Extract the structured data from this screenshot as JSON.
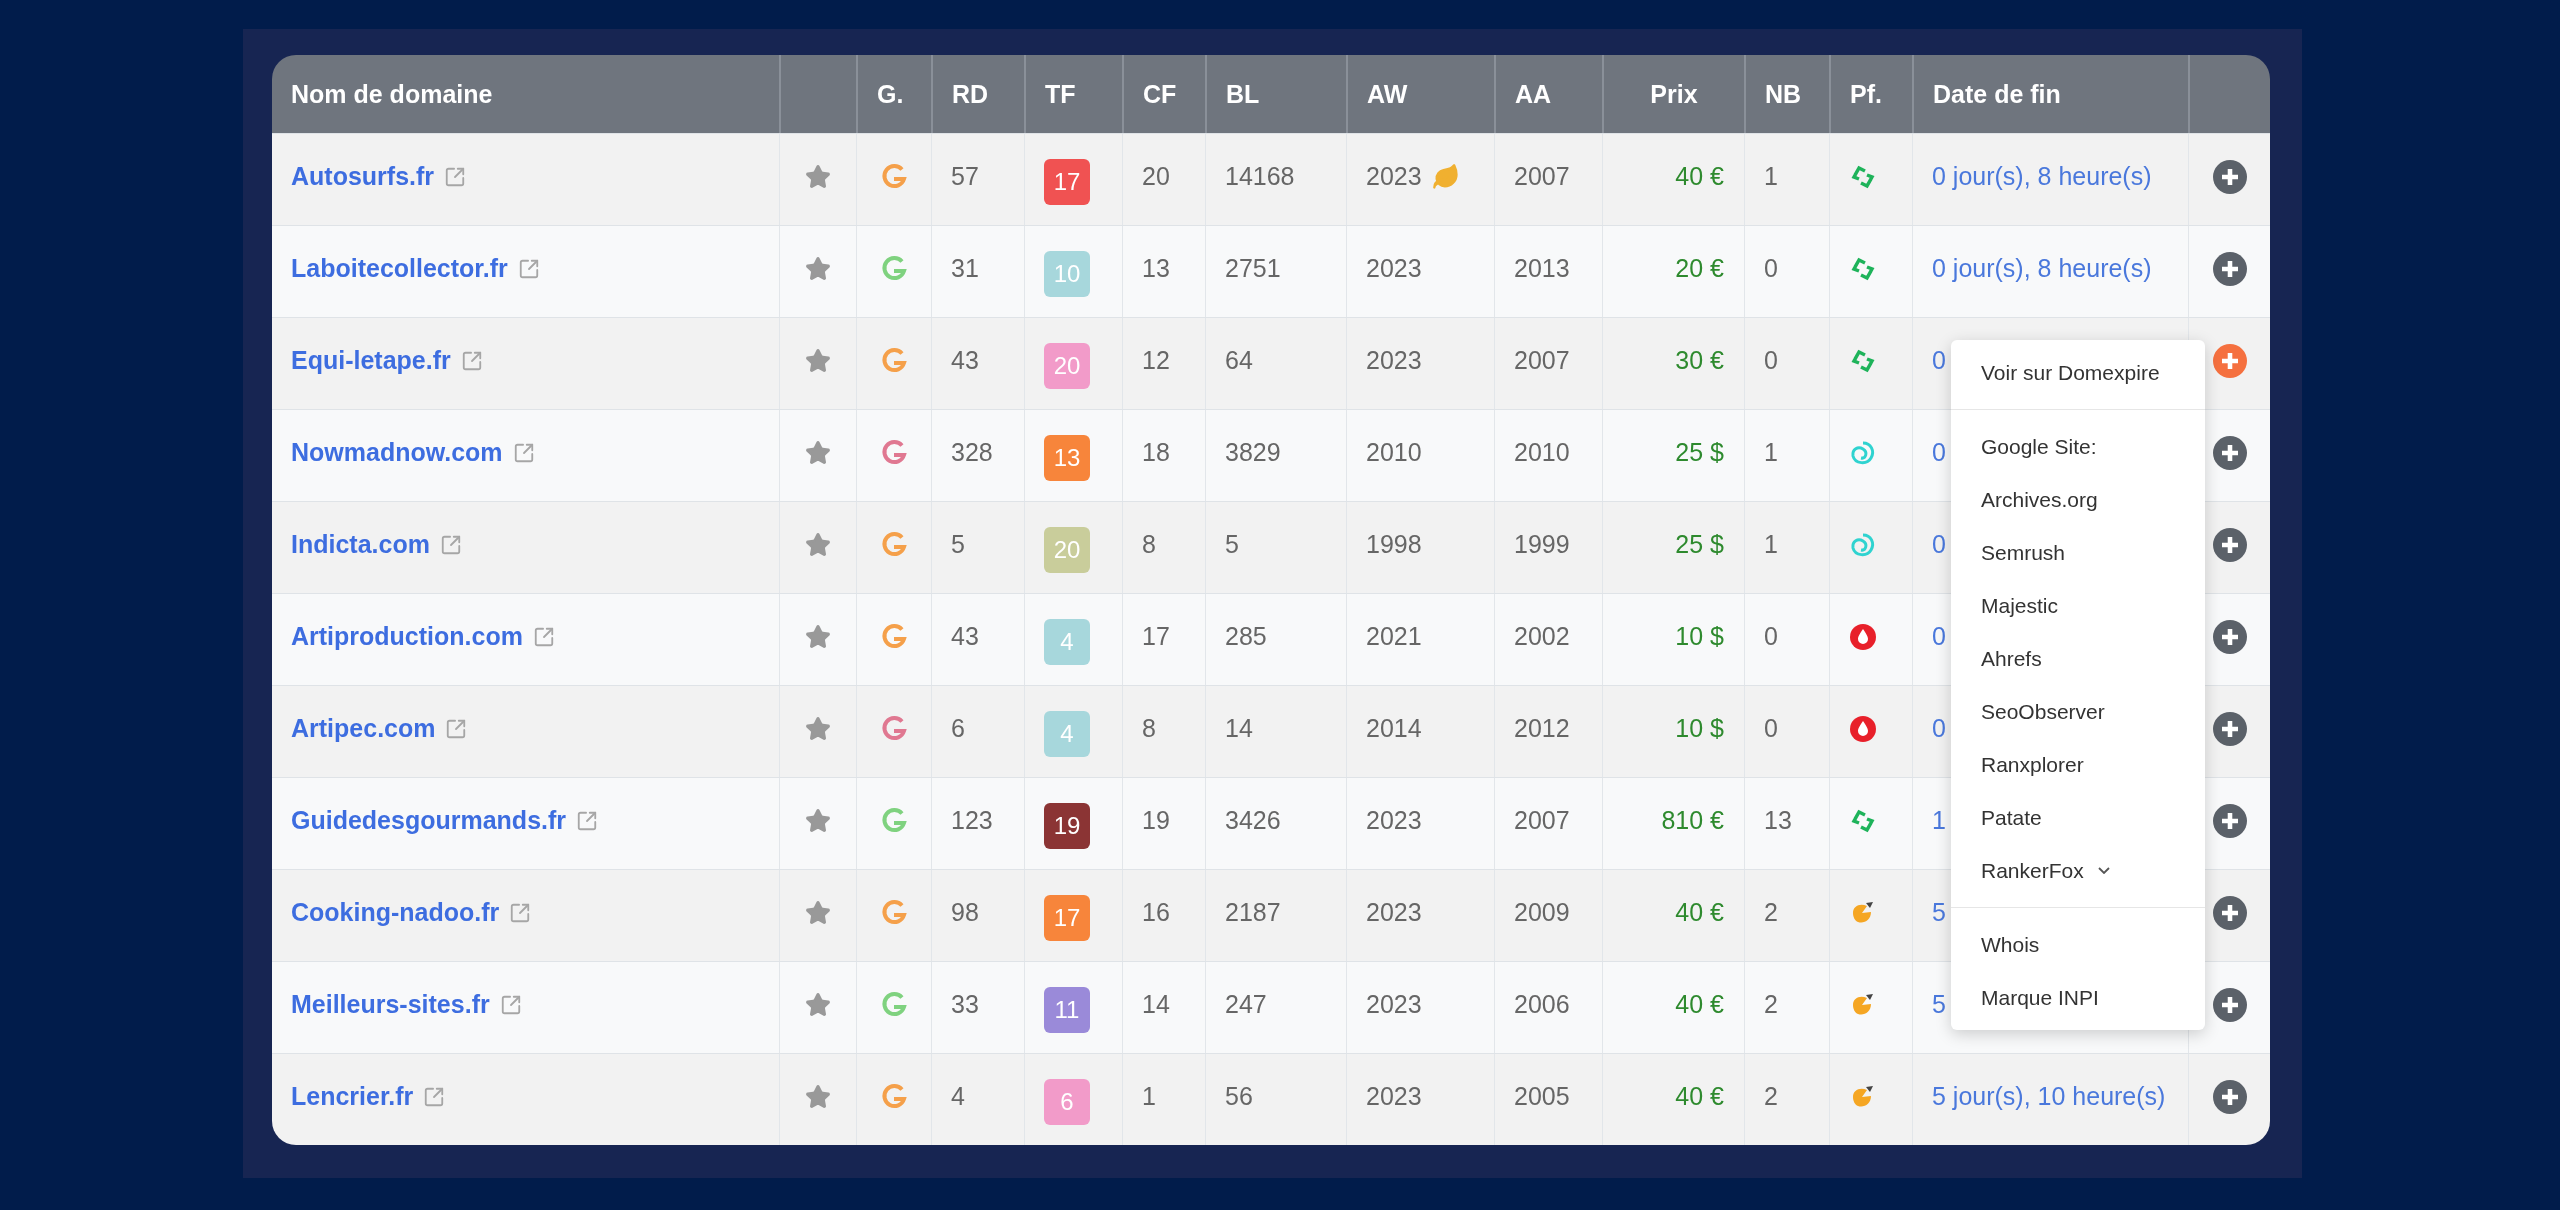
{
  "table": {
    "columns": [
      {
        "kind": "text",
        "label": "Nom de domaine"
      },
      {
        "kind": "blank"
      },
      {
        "kind": "text",
        "label": "G."
      },
      {
        "kind": "text",
        "label": "RD"
      },
      {
        "kind": "text",
        "label": "TF"
      },
      {
        "kind": "text",
        "label": "CF"
      },
      {
        "kind": "text",
        "label": "BL"
      },
      {
        "kind": "text",
        "label": "AW"
      },
      {
        "kind": "text",
        "label": "AA"
      },
      {
        "kind": "text",
        "label": "Prix"
      },
      {
        "kind": "text",
        "label": "NB"
      },
      {
        "kind": "text",
        "label": "Pf."
      },
      {
        "kind": "text",
        "label": "Date de fin"
      },
      {
        "kind": "blank"
      }
    ],
    "rows": [
      {
        "domain": "Autosurfs.fr",
        "g": {
          "color": "#f5a04a"
        },
        "rd": "57",
        "tf": {
          "value": "17",
          "color": "#f05252"
        },
        "cf": "20",
        "bl": "14168",
        "aw": "2023",
        "aw_leaf": true,
        "aa": "2007",
        "price": "40 €",
        "nb": "1",
        "pf": {
          "kind": "recycle"
        },
        "end_date": "0 jour(s), 8 heure(s)",
        "active": false
      },
      {
        "domain": "Laboitecollector.fr",
        "g": {
          "color": "#7fd27f"
        },
        "rd": "31",
        "tf": {
          "value": "10",
          "color": "#a7d7dc"
        },
        "cf": "13",
        "bl": "2751",
        "aw": "2023",
        "aw_leaf": false,
        "aa": "2013",
        "price": "20 €",
        "nb": "0",
        "pf": {
          "kind": "recycle"
        },
        "end_date": "0 jour(s), 8 heure(s)",
        "active": false
      },
      {
        "domain": "Equi-letape.fr",
        "g": {
          "color": "#f5a04a"
        },
        "rd": "43",
        "tf": {
          "value": "20",
          "color": "#f29bc9"
        },
        "cf": "12",
        "bl": "64",
        "aw": "2023",
        "aw_leaf": false,
        "aa": "2007",
        "price": "30 €",
        "nb": "0",
        "pf": {
          "kind": "recycle"
        },
        "end_date": "0",
        "active": true
      },
      {
        "domain": "Nowmadnow.com",
        "g": {
          "color": "#e07891"
        },
        "rd": "328",
        "tf": {
          "value": "13",
          "color": "#f7853b"
        },
        "cf": "18",
        "bl": "3829",
        "aw": "2010",
        "aw_leaf": false,
        "aa": "2010",
        "price": "25 $",
        "nb": "1",
        "pf": {
          "kind": "swirl"
        },
        "end_date": "0",
        "active": false
      },
      {
        "domain": "Indicta.com",
        "g": {
          "color": "#f5a04a"
        },
        "rd": "5",
        "tf": {
          "value": "20",
          "color": "#c9cd9b"
        },
        "cf": "8",
        "bl": "5",
        "aw": "1998",
        "aw_leaf": false,
        "aa": "1999",
        "price": "25 $",
        "nb": "1",
        "pf": {
          "kind": "swirl"
        },
        "end_date": "0",
        "active": false
      },
      {
        "domain": "Artiproduction.com",
        "g": {
          "color": "#f5a04a"
        },
        "rd": "43",
        "tf": {
          "value": "4",
          "color": "#a7d7dc"
        },
        "cf": "17",
        "bl": "285",
        "aw": "2021",
        "aw_leaf": false,
        "aa": "2002",
        "price": "10 $",
        "nb": "0",
        "pf": {
          "kind": "drop"
        },
        "end_date": "0",
        "active": false
      },
      {
        "domain": "Artipec.com",
        "g": {
          "color": "#e07891"
        },
        "rd": "6",
        "tf": {
          "value": "4",
          "color": "#a7d7dc"
        },
        "cf": "8",
        "bl": "14",
        "aw": "2014",
        "aw_leaf": false,
        "aa": "2012",
        "price": "10 $",
        "nb": "0",
        "pf": {
          "kind": "drop"
        },
        "end_date": "0",
        "active": false
      },
      {
        "domain": "Guidedesgourmands.fr",
        "g": {
          "color": "#7fd27f"
        },
        "rd": "123",
        "tf": {
          "value": "19",
          "color": "#8b3434"
        },
        "cf": "19",
        "bl": "3426",
        "aw": "2023",
        "aw_leaf": false,
        "aa": "2007",
        "price": "810 €",
        "nb": "13",
        "pf": {
          "kind": "recycle"
        },
        "end_date": "1",
        "active": false
      },
      {
        "domain": "Cooking-nadoo.fr",
        "g": {
          "color": "#f5a04a"
        },
        "rd": "98",
        "tf": {
          "value": "17",
          "color": "#f7853b"
        },
        "cf": "16",
        "bl": "2187",
        "aw": "2023",
        "aw_leaf": false,
        "aa": "2009",
        "price": "40 €",
        "nb": "2",
        "pf": {
          "kind": "chick"
        },
        "end_date": "5",
        "active": false
      },
      {
        "domain": "Meilleurs-sites.fr",
        "g": {
          "color": "#7fd27f"
        },
        "rd": "33",
        "tf": {
          "value": "11",
          "color": "#9a8ad9"
        },
        "cf": "14",
        "bl": "247",
        "aw": "2023",
        "aw_leaf": false,
        "aa": "2006",
        "price": "40 €",
        "nb": "2",
        "pf": {
          "kind": "chick"
        },
        "end_date": "5",
        "active": false
      },
      {
        "domain": "Lencrier.fr",
        "g": {
          "color": "#f5a04a"
        },
        "rd": "4",
        "tf": {
          "value": "6",
          "color": "#f29bc9"
        },
        "cf": "1",
        "bl": "56",
        "aw": "2023",
        "aw_leaf": false,
        "aa": "2005",
        "price": "40 €",
        "nb": "2",
        "pf": {
          "kind": "chick"
        },
        "end_date": "5 jour(s), 10 heure(s)",
        "active": false
      }
    ]
  },
  "menu": {
    "sections": [
      [
        {
          "label": "Voir sur Domexpire"
        }
      ],
      [
        {
          "label": "Google Site:"
        },
        {
          "label": "Archives.org"
        },
        {
          "label": "Semrush"
        },
        {
          "label": "Majestic"
        },
        {
          "label": "Ahrefs"
        },
        {
          "label": "SeoObserver"
        },
        {
          "label": "Ranxplorer"
        },
        {
          "label": "Patate"
        },
        {
          "label": "RankerFox",
          "submenu": true
        }
      ],
      [
        {
          "label": "Whois"
        },
        {
          "label": "Marque INPI"
        }
      ]
    ]
  }
}
